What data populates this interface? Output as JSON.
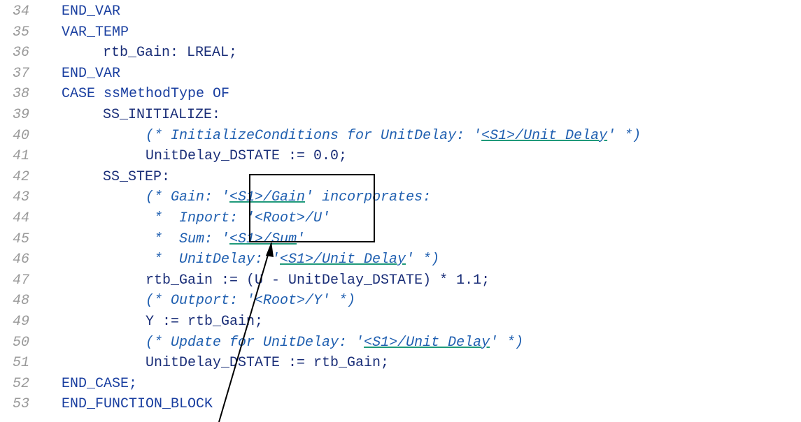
{
  "code_lines": [
    {
      "num": "34",
      "indent": 0,
      "segments": [
        {
          "t": "END_VAR",
          "c": "kw"
        }
      ]
    },
    {
      "num": "35",
      "indent": 0,
      "segments": [
        {
          "t": "VAR_TEMP",
          "c": "kw"
        }
      ]
    },
    {
      "num": "36",
      "indent": 1,
      "segments": [
        {
          "t": "rtb_Gain: LREAL;",
          "c": "code"
        }
      ]
    },
    {
      "num": "37",
      "indent": 0,
      "segments": [
        {
          "t": "END_VAR",
          "c": "kw"
        }
      ]
    },
    {
      "num": "38",
      "indent": 0,
      "segments": [
        {
          "t": "CASE ssMethodType OF",
          "c": "kw"
        }
      ]
    },
    {
      "num": "39",
      "indent": 1,
      "segments": [
        {
          "t": "SS_INITIALIZE:",
          "c": "code"
        }
      ]
    },
    {
      "num": "40",
      "indent": 2,
      "segments": [
        {
          "t": "(* InitializeConditions for UnitDelay: '",
          "c": "cm"
        },
        {
          "t": "<S1>/Unit Delay",
          "c": "lnk"
        },
        {
          "t": "' *)",
          "c": "cm"
        }
      ]
    },
    {
      "num": "41",
      "indent": 2,
      "segments": [
        {
          "t": "UnitDelay_DSTATE := 0.0;",
          "c": "code"
        }
      ]
    },
    {
      "num": "42",
      "indent": 1,
      "segments": [
        {
          "t": "SS_STEP:",
          "c": "code"
        }
      ]
    },
    {
      "num": "43",
      "indent": 2,
      "segments": [
        {
          "t": "(* Gain: '",
          "c": "cm"
        },
        {
          "t": "<S1>/Gain",
          "c": "lnk"
        },
        {
          "t": "' incorporates:",
          "c": "cm"
        }
      ]
    },
    {
      "num": "44",
      "indent": 2,
      "segments": [
        {
          "t": " *  Inport: '<Root>/U'",
          "c": "cm"
        }
      ]
    },
    {
      "num": "45",
      "indent": 2,
      "segments": [
        {
          "t": " *  Sum: '",
          "c": "cm"
        },
        {
          "t": "<S1>/Sum",
          "c": "lnk"
        },
        {
          "t": "'",
          "c": "cm"
        }
      ]
    },
    {
      "num": "46",
      "indent": 2,
      "segments": [
        {
          "t": " *  UnitDelay: '",
          "c": "cm"
        },
        {
          "t": "<S1>/Unit Delay",
          "c": "lnk"
        },
        {
          "t": "' *)",
          "c": "cm"
        }
      ]
    },
    {
      "num": "47",
      "indent": 2,
      "segments": [
        {
          "t": "rtb_Gain := (U - UnitDelay_DSTATE) * 1.1;",
          "c": "code"
        }
      ]
    },
    {
      "num": "48",
      "indent": 2,
      "segments": [
        {
          "t": "(* Outport: '<Root>/Y' *)",
          "c": "cm"
        }
      ]
    },
    {
      "num": "49",
      "indent": 2,
      "segments": [
        {
          "t": "Y := rtb_Gain;",
          "c": "code"
        }
      ]
    },
    {
      "num": "50",
      "indent": 2,
      "segments": [
        {
          "t": "(* Update for UnitDelay: '",
          "c": "cm"
        },
        {
          "t": "<S1>/Unit Delay",
          "c": "lnk"
        },
        {
          "t": "' *)",
          "c": "cm"
        }
      ]
    },
    {
      "num": "51",
      "indent": 2,
      "segments": [
        {
          "t": "UnitDelay_DSTATE := rtb_Gain;",
          "c": "code"
        }
      ]
    },
    {
      "num": "52",
      "indent": 0,
      "segments": [
        {
          "t": "END_CASE;",
          "c": "kw"
        }
      ]
    },
    {
      "num": "53",
      "indent": 0,
      "segments": [
        {
          "t": "END_FUNCTION_BLOCK",
          "c": "kw"
        }
      ]
    }
  ],
  "colors": {
    "keyword": "#1a3fa0",
    "code": "#1a2e78",
    "comment": "#1f5fb0",
    "link_underline": "#1f9a7a",
    "line_number": "#9a9a9a",
    "annotation": "#000000"
  }
}
